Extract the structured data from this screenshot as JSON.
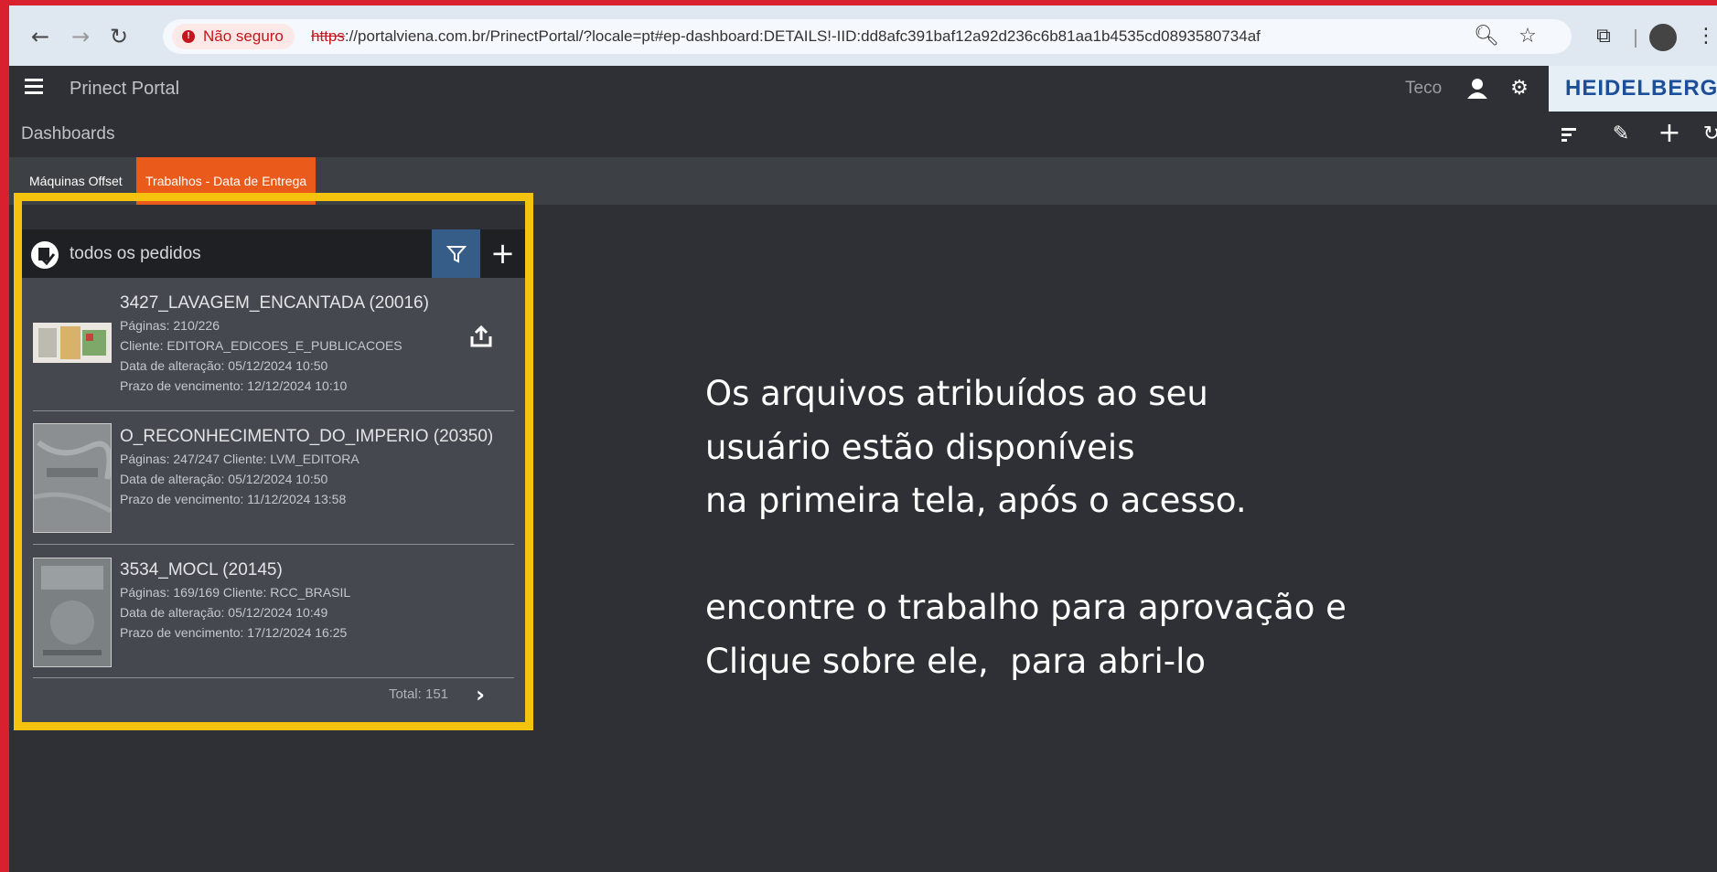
{
  "browser": {
    "security_label": "Não seguro",
    "url_scheme": "https",
    "url_rest": "://portalviena.com.br/PrinectPortal/?locale=pt#ep-dashboard:DETAILS!-IID:dd8afc391baf12a92d236c6b81aa1b4535cd0893580734af"
  },
  "header": {
    "app_title": "Prinect Portal",
    "user": "Teco",
    "logo_text": "HEIDELBERG"
  },
  "subheader": {
    "title": "Dashboards"
  },
  "tabs": [
    {
      "label": "Máquinas Offset",
      "active": false
    },
    {
      "label": "Trabalhos - Data de Entrega",
      "active": true
    }
  ],
  "widget": {
    "title": "todos os pedidos",
    "jobs": [
      {
        "title": "3427_LAVAGEM_ENCANTADA (20016)",
        "lines": [
          "Páginas: 210/226",
          "Cliente: EDITORA_EDICOES_E_PUBLICACOES",
          "Data de alteração: 05/12/2024 10:50",
          "Prazo de vencimento: 12/12/2024 10:10"
        ]
      },
      {
        "title": "O_RECONHECIMENTO_DO_IMPERIO (20350)",
        "lines": [
          "Páginas: 247/247  Cliente: LVM_EDITORA",
          "Data de alteração: 05/12/2024 10:50",
          "Prazo de vencimento: 11/12/2024 13:58"
        ]
      },
      {
        "title": "3534_MOCL (20145)",
        "lines": [
          "Páginas: 169/169  Cliente: RCC_BRASIL",
          "Data de alteração: 05/12/2024 10:49",
          "Prazo de vencimento: 17/12/2024 16:25"
        ]
      }
    ],
    "total": "Total: 151"
  },
  "instructions": {
    "line1": "Os arquivos atribuídos ao seu",
    "line2": "usuário estão disponíveis",
    "line3": "na primeira tela, após o acesso.",
    "line4": "encontre o trabalho para aprovação e",
    "line5": "Clique sobre ele,  para abri-lo"
  },
  "colors": {
    "frame": "#d8202e",
    "highlight": "#f5c20d",
    "active_tab": "#ea5b1b",
    "filter_button": "#355d88"
  }
}
